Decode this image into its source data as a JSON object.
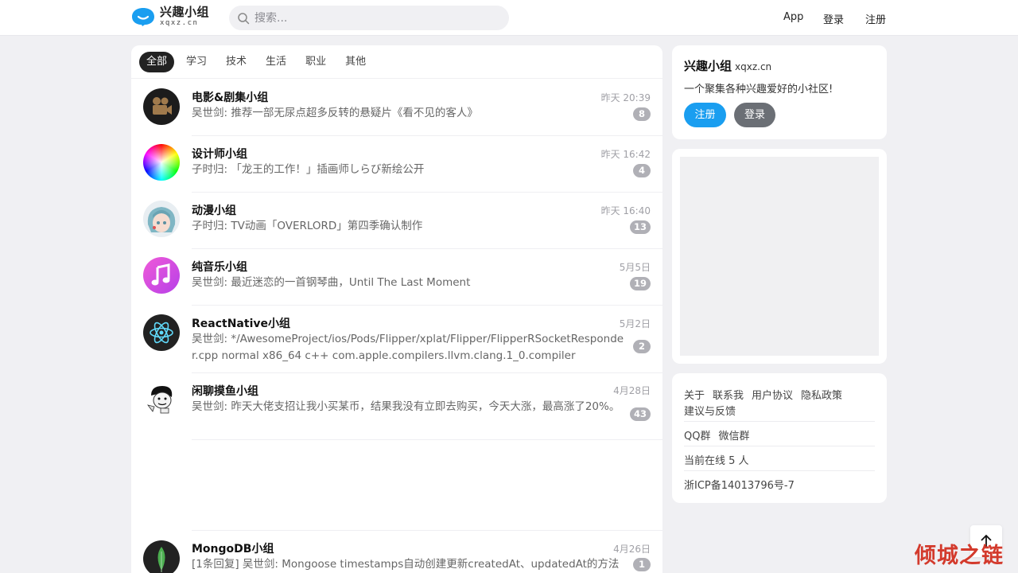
{
  "header": {
    "logo_title": "兴趣小组",
    "logo_sub": "xqxz.cn",
    "search_placeholder": "搜索...",
    "nav": {
      "app": "App",
      "login": "登录",
      "register": "注册"
    }
  },
  "tabs": [
    {
      "label": "全部",
      "active": true
    },
    {
      "label": "学习",
      "active": false
    },
    {
      "label": "技术",
      "active": false
    },
    {
      "label": "生活",
      "active": false
    },
    {
      "label": "职业",
      "active": false
    },
    {
      "label": "其他",
      "active": false
    }
  ],
  "groups": [
    {
      "name": "电影&剧集小组",
      "post": "吴世剑: 推荐一部无尿点超多反转的悬疑片《看不见的客人》",
      "time": "昨天 20:39",
      "count": "8",
      "icon": "film-camera-icon"
    },
    {
      "name": "设计师小组",
      "post": "子时归: 「龙王的工作！」插画师しらび新绘公开",
      "time": "昨天 16:42",
      "count": "4",
      "icon": "color-wheel-icon"
    },
    {
      "name": "动漫小组",
      "post": "子时归: TV动画「OVERLORD」第四季确认制作",
      "time": "昨天 16:40",
      "count": "13",
      "icon": "anime-avatar-icon"
    },
    {
      "name": "纯音乐小组",
      "post": "吴世剑: 最近迷恋的一首钢琴曲，Until The Last Moment",
      "time": "5月5日",
      "count": "19",
      "icon": "music-note-icon"
    },
    {
      "name": "ReactNative小组",
      "post": "吴世剑: */AwesomeProject/ios/Pods/Flipper/xplat/Flipper/FlipperRSocketResponder.cpp normal x86_64 c++ com.apple.compilers.llvm.clang.1_0.compiler",
      "time": "5月2日",
      "count": "2",
      "icon": "react-atom-icon"
    },
    {
      "name": "闲聊摸鱼小组",
      "post": "吴世剑: 昨天大佬支招让我小买某币，结果我没有立即去购买，今天大涨，最高涨了20%。",
      "time": "4月28日",
      "count": "43",
      "icon": "cartoon-meme-icon"
    },
    {
      "name": "MongoDB小组",
      "post": "[1条回复] 吴世剑: Mongoose timestamps自动创建更新createdAt、updatedAt的方法",
      "time": "4月26日",
      "count": "1",
      "icon": "mongodb-leaf-icon"
    }
  ],
  "sidebar": {
    "site_title": "兴趣小组",
    "site_domain": "xqxz.cn",
    "site_desc": "一个聚集各种兴趣爱好的小社区!",
    "register_btn": "注册",
    "login_btn": "登录",
    "links_row1": [
      "关于",
      "联系我",
      "用户协议",
      "隐私政策"
    ],
    "links_row1b": "建议与反馈",
    "links_row2": [
      "QQ群",
      "微信群"
    ],
    "online": "当前在线 5 人",
    "icp": "浙ICP备14013796号-7"
  },
  "watermark": "倾城之链",
  "colors": {
    "accent": "#1a9ef0",
    "dark": "#222222",
    "badge": "#b0b0b6"
  }
}
